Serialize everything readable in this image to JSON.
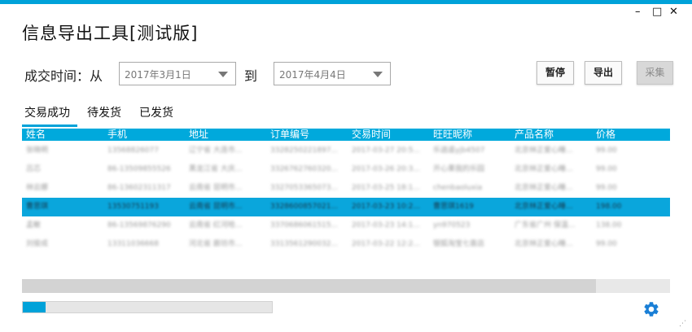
{
  "window": {
    "title": "信息导出工具[测试版]",
    "controls": [
      "–",
      "□",
      "✕"
    ],
    "accent": "#00a2d9"
  },
  "filter": {
    "label": "成交时间：从",
    "to_label": "到",
    "start_date": "2017年3月1日",
    "end_date": "2017年4月4日"
  },
  "buttons": {
    "pause": "暂停",
    "export": "导出",
    "collect": "采集"
  },
  "tabs": [
    {
      "label": "交易成功",
      "active": true
    },
    {
      "label": "待发货",
      "active": false
    },
    {
      "label": "已发货",
      "active": false
    }
  ],
  "table": {
    "columns": [
      "姓名",
      "手机",
      "地址",
      "订单编号",
      "交易时间",
      "旺旺昵称",
      "产品名称",
      "价格"
    ],
    "rows": [
      [
        "张晓明",
        "13568826077",
        "辽宁省 大连市...",
        "3328250221897...",
        "2017-03-27 20:5...",
        "乐逍遥yjb4507",
        "北京林正爱心睡...",
        "99.00"
      ],
      [
        "吕芯",
        "86-13509855526",
        "黑龙江省 大庆...",
        "3326762760320...",
        "2017-03-26 20:3...",
        "开心果我的乐园",
        "北京林正爱心睡...",
        "99.00"
      ],
      [
        "林云娜",
        "86-13602311317",
        "云南省 昆明市...",
        "3327053365073...",
        "2017-03-25 18:1...",
        "chenbaoluxia",
        "北京林正爱心睡...",
        "99.00"
      ],
      [
        "曹思琪",
        "13530751193",
        "云南省 昆明市...",
        "3328600857021...",
        "2017-03-23 10:2...",
        "曹思琪1619",
        "北京林正爱心睡...",
        "198.00"
      ],
      [
        "孟敏",
        "86-13569876290",
        "云南省 红河哈...",
        "3370686061515...",
        "2017-03-23 14:1...",
        "yn970523",
        "广东省广州 保温...",
        "138.00"
      ],
      [
        "刘俊成",
        "13311036668",
        "河北省 廊坊市...",
        "3313561290032...",
        "2017-03-22 12:2...",
        "银狐淘宝七喜店",
        "北京林正爱心睡...",
        "99.00"
      ]
    ],
    "selected_row": 3
  },
  "progress": {
    "value": 0.09
  },
  "icons": {
    "settings": "gear-icon",
    "resize": "resize-grip-icon"
  }
}
